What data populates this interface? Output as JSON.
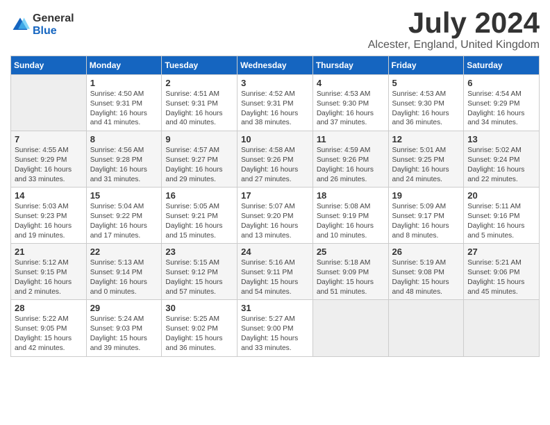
{
  "logo": {
    "general": "General",
    "blue": "Blue"
  },
  "title": "July 2024",
  "location": "Alcester, England, United Kingdom",
  "days_of_week": [
    "Sunday",
    "Monday",
    "Tuesday",
    "Wednesday",
    "Thursday",
    "Friday",
    "Saturday"
  ],
  "weeks": [
    [
      {
        "day": "",
        "content": ""
      },
      {
        "day": "1",
        "content": "Sunrise: 4:50 AM\nSunset: 9:31 PM\nDaylight: 16 hours\nand 41 minutes."
      },
      {
        "day": "2",
        "content": "Sunrise: 4:51 AM\nSunset: 9:31 PM\nDaylight: 16 hours\nand 40 minutes."
      },
      {
        "day": "3",
        "content": "Sunrise: 4:52 AM\nSunset: 9:31 PM\nDaylight: 16 hours\nand 38 minutes."
      },
      {
        "day": "4",
        "content": "Sunrise: 4:53 AM\nSunset: 9:30 PM\nDaylight: 16 hours\nand 37 minutes."
      },
      {
        "day": "5",
        "content": "Sunrise: 4:53 AM\nSunset: 9:30 PM\nDaylight: 16 hours\nand 36 minutes."
      },
      {
        "day": "6",
        "content": "Sunrise: 4:54 AM\nSunset: 9:29 PM\nDaylight: 16 hours\nand 34 minutes."
      }
    ],
    [
      {
        "day": "7",
        "content": "Sunrise: 4:55 AM\nSunset: 9:29 PM\nDaylight: 16 hours\nand 33 minutes."
      },
      {
        "day": "8",
        "content": "Sunrise: 4:56 AM\nSunset: 9:28 PM\nDaylight: 16 hours\nand 31 minutes."
      },
      {
        "day": "9",
        "content": "Sunrise: 4:57 AM\nSunset: 9:27 PM\nDaylight: 16 hours\nand 29 minutes."
      },
      {
        "day": "10",
        "content": "Sunrise: 4:58 AM\nSunset: 9:26 PM\nDaylight: 16 hours\nand 27 minutes."
      },
      {
        "day": "11",
        "content": "Sunrise: 4:59 AM\nSunset: 9:26 PM\nDaylight: 16 hours\nand 26 minutes."
      },
      {
        "day": "12",
        "content": "Sunrise: 5:01 AM\nSunset: 9:25 PM\nDaylight: 16 hours\nand 24 minutes."
      },
      {
        "day": "13",
        "content": "Sunrise: 5:02 AM\nSunset: 9:24 PM\nDaylight: 16 hours\nand 22 minutes."
      }
    ],
    [
      {
        "day": "14",
        "content": "Sunrise: 5:03 AM\nSunset: 9:23 PM\nDaylight: 16 hours\nand 19 minutes."
      },
      {
        "day": "15",
        "content": "Sunrise: 5:04 AM\nSunset: 9:22 PM\nDaylight: 16 hours\nand 17 minutes."
      },
      {
        "day": "16",
        "content": "Sunrise: 5:05 AM\nSunset: 9:21 PM\nDaylight: 16 hours\nand 15 minutes."
      },
      {
        "day": "17",
        "content": "Sunrise: 5:07 AM\nSunset: 9:20 PM\nDaylight: 16 hours\nand 13 minutes."
      },
      {
        "day": "18",
        "content": "Sunrise: 5:08 AM\nSunset: 9:19 PM\nDaylight: 16 hours\nand 10 minutes."
      },
      {
        "day": "19",
        "content": "Sunrise: 5:09 AM\nSunset: 9:17 PM\nDaylight: 16 hours\nand 8 minutes."
      },
      {
        "day": "20",
        "content": "Sunrise: 5:11 AM\nSunset: 9:16 PM\nDaylight: 16 hours\nand 5 minutes."
      }
    ],
    [
      {
        "day": "21",
        "content": "Sunrise: 5:12 AM\nSunset: 9:15 PM\nDaylight: 16 hours\nand 2 minutes."
      },
      {
        "day": "22",
        "content": "Sunrise: 5:13 AM\nSunset: 9:14 PM\nDaylight: 16 hours\nand 0 minutes."
      },
      {
        "day": "23",
        "content": "Sunrise: 5:15 AM\nSunset: 9:12 PM\nDaylight: 15 hours\nand 57 minutes."
      },
      {
        "day": "24",
        "content": "Sunrise: 5:16 AM\nSunset: 9:11 PM\nDaylight: 15 hours\nand 54 minutes."
      },
      {
        "day": "25",
        "content": "Sunrise: 5:18 AM\nSunset: 9:09 PM\nDaylight: 15 hours\nand 51 minutes."
      },
      {
        "day": "26",
        "content": "Sunrise: 5:19 AM\nSunset: 9:08 PM\nDaylight: 15 hours\nand 48 minutes."
      },
      {
        "day": "27",
        "content": "Sunrise: 5:21 AM\nSunset: 9:06 PM\nDaylight: 15 hours\nand 45 minutes."
      }
    ],
    [
      {
        "day": "28",
        "content": "Sunrise: 5:22 AM\nSunset: 9:05 PM\nDaylight: 15 hours\nand 42 minutes."
      },
      {
        "day": "29",
        "content": "Sunrise: 5:24 AM\nSunset: 9:03 PM\nDaylight: 15 hours\nand 39 minutes."
      },
      {
        "day": "30",
        "content": "Sunrise: 5:25 AM\nSunset: 9:02 PM\nDaylight: 15 hours\nand 36 minutes."
      },
      {
        "day": "31",
        "content": "Sunrise: 5:27 AM\nSunset: 9:00 PM\nDaylight: 15 hours\nand 33 minutes."
      },
      {
        "day": "",
        "content": ""
      },
      {
        "day": "",
        "content": ""
      },
      {
        "day": "",
        "content": ""
      }
    ]
  ]
}
